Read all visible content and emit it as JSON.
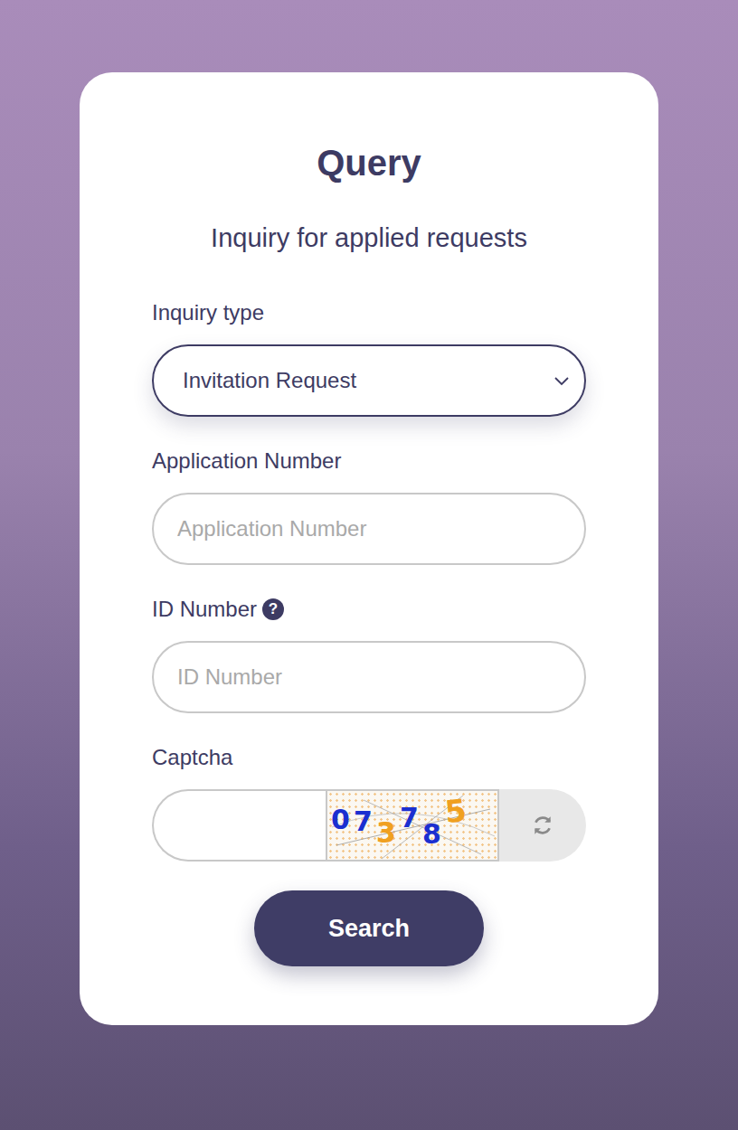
{
  "card": {
    "title": "Query",
    "subtitle": "Inquiry for applied requests"
  },
  "inquiry_type": {
    "label": "Inquiry type",
    "value": "Invitation Request"
  },
  "application_number": {
    "label": "Application Number",
    "placeholder": "Application Number"
  },
  "id_number": {
    "label": "ID Number",
    "help": "?",
    "placeholder": "ID Number"
  },
  "captcha": {
    "label": "Captcha",
    "value": "",
    "digits": [
      {
        "char": "0",
        "color": "#1b2fd0"
      },
      {
        "char": "7",
        "color": "#1b2fd0"
      },
      {
        "char": "3",
        "color": "#f0a020"
      },
      {
        "char": "7",
        "color": "#1b2fd0"
      },
      {
        "char": "8",
        "color": "#1b2fd0"
      },
      {
        "char": "5",
        "color": "#f0a020"
      }
    ]
  },
  "search_button": "Search"
}
